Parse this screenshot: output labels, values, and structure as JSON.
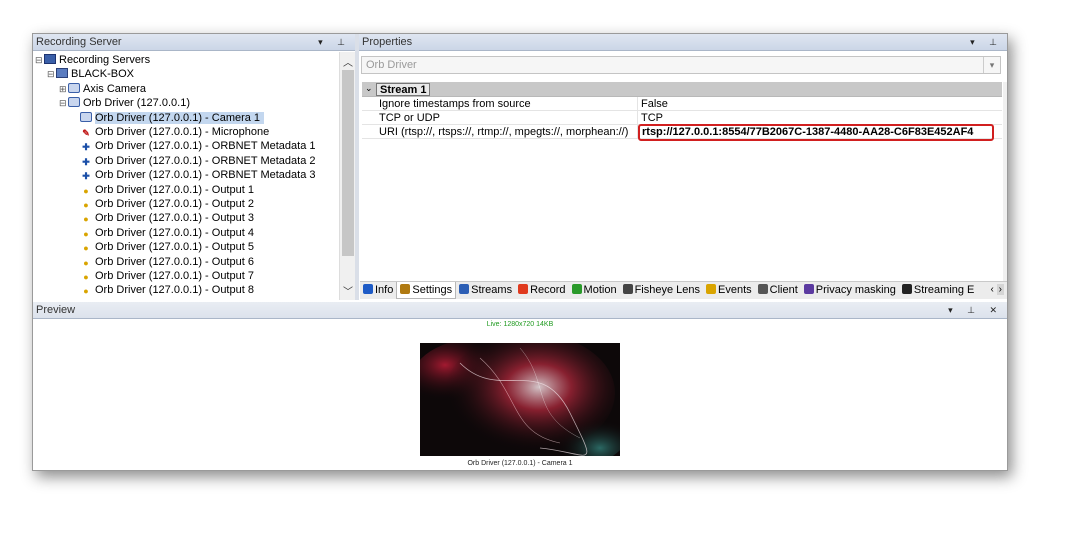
{
  "recording_server_pane": {
    "title": "Recording Server",
    "header_buttons": "▾ ⊥",
    "tree": [
      {
        "label": "Recording Servers",
        "icon": "server-icon",
        "toggle": "⊟"
      },
      {
        "label": "BLACK-BOX",
        "icon": "server-box-icon",
        "toggle": "⊟"
      },
      {
        "label": "Axis Camera",
        "icon": "camera-device-icon",
        "toggle": "⊞"
      },
      {
        "label": "Orb Driver (127.0.0.1)",
        "icon": "camera-device-icon",
        "toggle": "⊟"
      },
      {
        "label": "Orb Driver (127.0.0.1) - Camera 1",
        "icon": "camera-icon",
        "selected": true
      },
      {
        "label": "Orb Driver (127.0.0.1) - Microphone",
        "icon": "microphone-icon"
      },
      {
        "label": "Orb Driver (127.0.0.1) - ORBNET Metadata 1",
        "icon": "metadata-icon"
      },
      {
        "label": "Orb Driver (127.0.0.1) - ORBNET Metadata 2",
        "icon": "metadata-icon"
      },
      {
        "label": "Orb Driver (127.0.0.1) - ORBNET Metadata 3",
        "icon": "metadata-icon"
      },
      {
        "label": "Orb Driver (127.0.0.1) - Output 1",
        "icon": "output-icon"
      },
      {
        "label": "Orb Driver (127.0.0.1) - Output 2",
        "icon": "output-icon"
      },
      {
        "label": "Orb Driver (127.0.0.1) - Output 3",
        "icon": "output-icon"
      },
      {
        "label": "Orb Driver (127.0.0.1) - Output 4",
        "icon": "output-icon"
      },
      {
        "label": "Orb Driver (127.0.0.1) - Output 5",
        "icon": "output-icon"
      },
      {
        "label": "Orb Driver (127.0.0.1) - Output 6",
        "icon": "output-icon"
      },
      {
        "label": "Orb Driver (127.0.0.1) - Output 7",
        "icon": "output-icon"
      },
      {
        "label": "Orb Driver (127.0.0.1) - Output 8",
        "icon": "output-icon"
      }
    ]
  },
  "properties_pane": {
    "title": "Properties",
    "header_buttons": "▾ ⊥",
    "device_select": "Orb Driver",
    "category": "Stream 1",
    "rows": [
      {
        "key": "Ignore timestamps from source",
        "value": "False"
      },
      {
        "key": "TCP or UDP",
        "value": "TCP"
      },
      {
        "key": "URI (rtsp://, rtsps://, rtmp://, mpegts://, morphean://)",
        "value": "rtsp://127.0.0.1:8554/77B2067C-1387-4480-AA28-C6F83E452AF4"
      }
    ],
    "tabs": [
      {
        "label": "Info",
        "icon": "info-icon",
        "color": "#1e5bc6"
      },
      {
        "label": "Settings",
        "icon": "settings-icon",
        "color": "#b07a12",
        "active": true
      },
      {
        "label": "Streams",
        "icon": "streams-icon",
        "color": "#2d5fb5"
      },
      {
        "label": "Record",
        "icon": "record-icon",
        "color": "#e03a1e"
      },
      {
        "label": "Motion",
        "icon": "motion-icon",
        "color": "#2a9a2a"
      },
      {
        "label": "Fisheye Lens",
        "icon": "fisheye-icon",
        "color": "#444"
      },
      {
        "label": "Events",
        "icon": "events-icon",
        "color": "#d9a400"
      },
      {
        "label": "Client",
        "icon": "client-icon",
        "color": "#555"
      },
      {
        "label": "Privacy masking",
        "icon": "privacy-icon",
        "color": "#5b3aa0"
      },
      {
        "label": "Streaming E",
        "icon": "streaming-icon",
        "color": "#222"
      }
    ]
  },
  "preview_pane": {
    "title": "Preview",
    "header_buttons": "▾ ⊥ ✕",
    "live_text": "Live: 1280x720 14KB",
    "caption": "Orb Driver (127.0.0.1) - Camera 1"
  },
  "colors": {
    "selection": "#c3d7ef",
    "highlight_border": "#d11f1f",
    "live_text": "#1f9a1f"
  }
}
